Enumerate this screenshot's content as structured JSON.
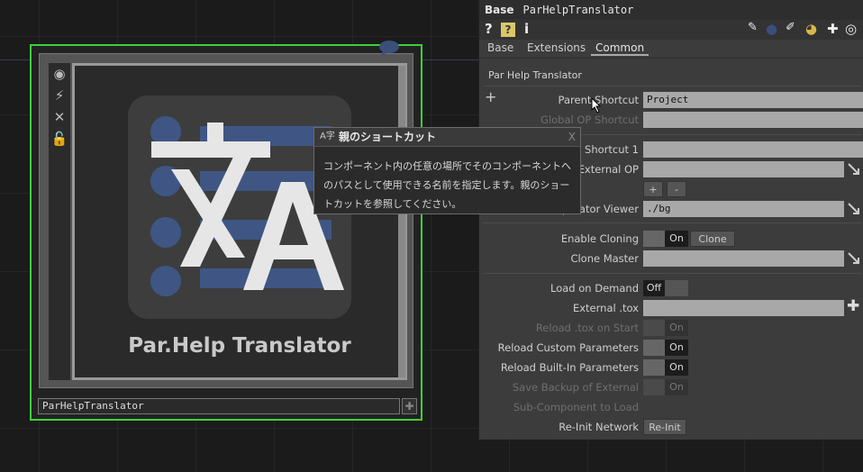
{
  "node": {
    "name": "ParHelpTranslator",
    "logo_title": "Par.Help Translator",
    "toolbar_icons": [
      "viewer-active-icon",
      "cook-icon",
      "bypass-icon",
      "lock-icon"
    ]
  },
  "tooltip": {
    "title": "親のショートカット",
    "close": "X",
    "body": "コンポーネント内の任意の場所でそのコンポーネントへのパスとして使用できる名前を指定します。親のショートカットを参照してください。"
  },
  "panel": {
    "op_type": "Base",
    "op_name": "ParHelpTranslator",
    "tabs": [
      "Base",
      "Extensions",
      "Common"
    ],
    "active_tab": "Common",
    "page_name": "Par Help Translator",
    "params": {
      "parent_shortcut": {
        "label": "Parent Shortcut",
        "value": "Project"
      },
      "global_op_shortcut": {
        "label": "Global OP Shortcut",
        "value": ""
      },
      "shortcut1": {
        "label": "Shortcut 1",
        "value": ""
      },
      "external_op": {
        "label": "External OP",
        "value": ""
      },
      "operator_viewer": {
        "label": "Operator Viewer",
        "value": "./bg"
      },
      "enable_cloning": {
        "label": "Enable Cloning",
        "toggle": "On",
        "button": "Clone"
      },
      "clone_master": {
        "label": "Clone Master",
        "value": ""
      },
      "load_on_demand": {
        "label": "Load on Demand",
        "toggle": "Off"
      },
      "external_tox": {
        "label": "External .tox",
        "value": ""
      },
      "reload_tox_on_start": {
        "label": "Reload .tox on Start",
        "toggle": "On"
      },
      "reload_custom": {
        "label": "Reload Custom Parameters",
        "toggle": "On"
      },
      "reload_builtin": {
        "label": "Reload Built-In Parameters",
        "toggle": "On"
      },
      "save_backup": {
        "label": "Save Backup of External",
        "toggle": "On"
      },
      "subcomponent": {
        "label": "Sub-Component to Load"
      },
      "reinit_network": {
        "label": "Re-Init Network",
        "button": "Re-Init"
      }
    },
    "seq_buttons": [
      "+",
      "-"
    ],
    "add_plus": "+"
  }
}
